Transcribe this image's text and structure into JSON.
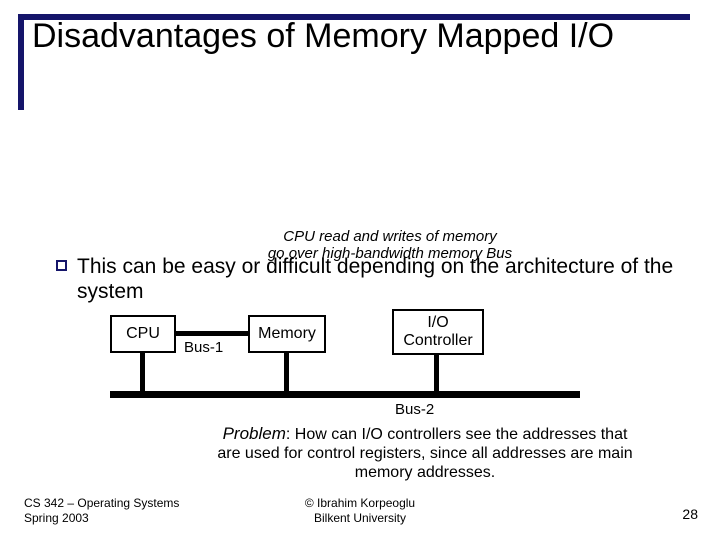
{
  "title": "Disadvantages of Memory Mapped I/O",
  "caption_line1": "CPU read and writes of memory",
  "caption_line2": "go over high-bandwidth memory Bus",
  "bullet": "This can be easy or difficult depending on the architecture of the system",
  "diagram": {
    "cpu": "CPU",
    "memory": "Memory",
    "io": "I/O Controller",
    "bus1": "Bus-1",
    "bus2": "Bus-2"
  },
  "problem_lead": "Problem",
  "problem_text": ": How can I/O controllers see the addresses that are used for control registers, since all addresses are main memory addresses.",
  "footer_course_a": "CS 342 – Operating Systems",
  "footer_course_b": "Spring 2003",
  "footer_center_a": "© Ibrahim Korpeoglu",
  "footer_center_b": "Bilkent University",
  "page_number": "28"
}
